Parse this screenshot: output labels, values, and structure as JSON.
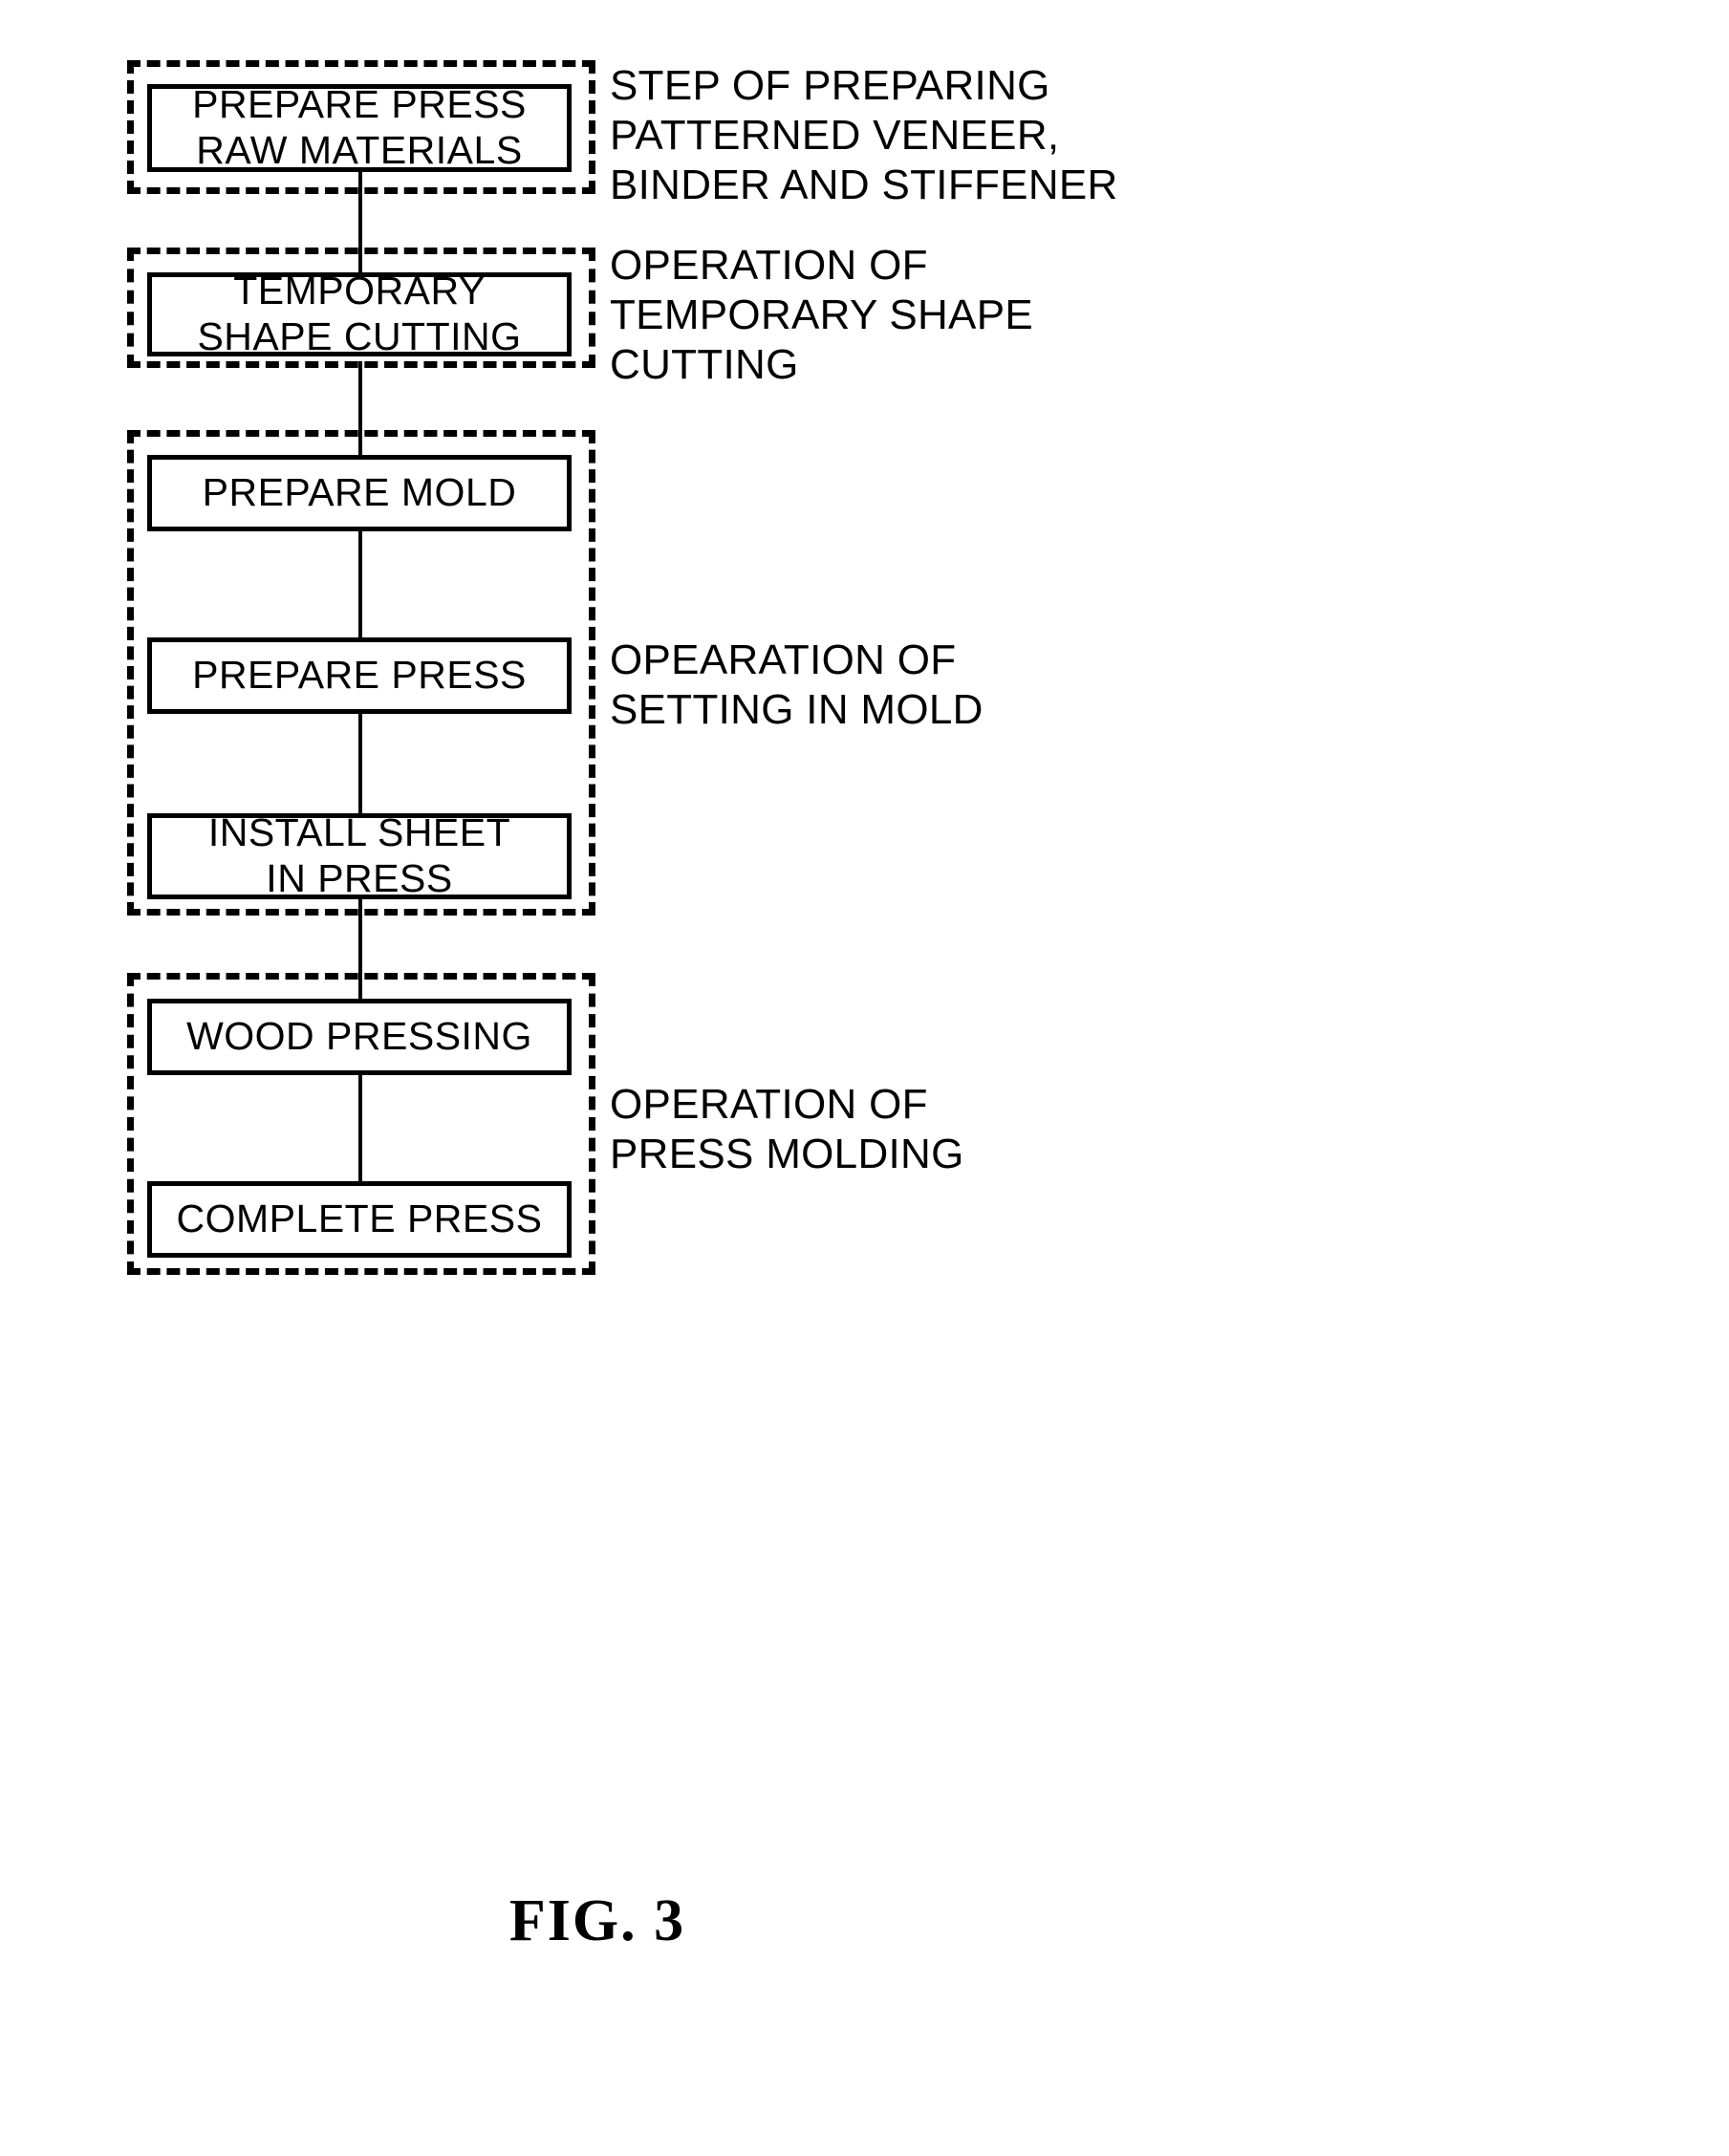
{
  "figure": {
    "caption": "FIG. 3",
    "title": "Process flowchart for press molding of patterned veneer"
  },
  "colors": {
    "ink": "#000000",
    "background": "#ffffff"
  },
  "groups": [
    {
      "id": "group-preparing",
      "annotation": "STEP OF PREPARING\nPATTERNED VENEER,\nBINDER AND STIFFENER",
      "steps": [
        {
          "id": "step-prepare-press-raw-materials",
          "label": "PREPARE PRESS\nRAW MATERIALS"
        }
      ]
    },
    {
      "id": "group-temporary-shape-cutting",
      "annotation": "OPERATION OF\nTEMPORARY SHAPE\nCUTTING",
      "steps": [
        {
          "id": "step-temporary-shape-cutting",
          "label": "TEMPORARY\nSHAPE CUTTING"
        }
      ]
    },
    {
      "id": "group-setting-in-mold",
      "annotation": "OPEARATION OF\nSETTING IN MOLD",
      "steps": [
        {
          "id": "step-prepare-mold",
          "label": "PREPARE MOLD"
        },
        {
          "id": "step-prepare-press",
          "label": "PREPARE PRESS"
        },
        {
          "id": "step-install-sheet-in-press",
          "label": "INSTALL SHEET\nIN PRESS"
        }
      ]
    },
    {
      "id": "group-press-molding",
      "annotation": "OPERATION OF\nPRESS MOLDING",
      "steps": [
        {
          "id": "step-wood-pressing",
          "label": "WOOD PRESSING"
        },
        {
          "id": "step-complete-press",
          "label": "COMPLETE PRESS"
        }
      ]
    }
  ],
  "flow": {
    "arrow_count": 6,
    "direction": "top-to-bottom"
  }
}
